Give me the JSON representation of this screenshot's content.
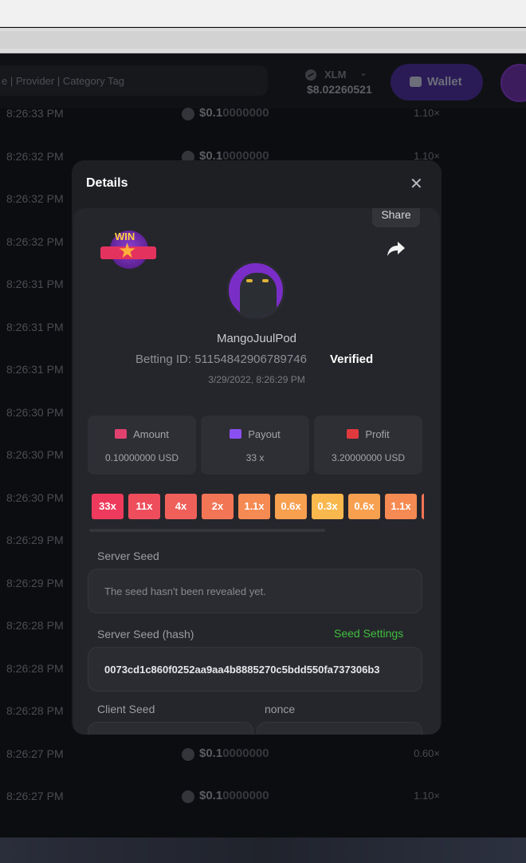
{
  "header": {
    "search_placeholder": "e | Provider | Category Tag",
    "currency_code": "XLM",
    "balance": "$8.02260521",
    "wallet_label": "Wallet"
  },
  "bets": [
    {
      "time": "8:26:33 PM",
      "amount_main": "$0.1",
      "amount_dim": "0000000",
      "multiplier": "1.10×",
      "show_amount": true,
      "show_mult": true
    },
    {
      "time": "8:26:32 PM",
      "amount_main": "$0.1",
      "amount_dim": "0000000",
      "multiplier": "1.10×",
      "show_amount": true,
      "show_mult": true
    },
    {
      "time": "8:26:32 PM",
      "show_amount": false,
      "show_mult": false
    },
    {
      "time": "8:26:32 PM",
      "show_amount": false,
      "show_mult": false
    },
    {
      "time": "8:26:31 PM",
      "show_amount": false,
      "show_mult": false
    },
    {
      "time": "8:26:31 PM",
      "show_amount": false,
      "show_mult": false
    },
    {
      "time": "8:26:31 PM",
      "show_amount": false,
      "show_mult": false
    },
    {
      "time": "8:26:30 PM",
      "show_amount": false,
      "show_mult": false
    },
    {
      "time": "8:26:30 PM",
      "show_amount": false,
      "show_mult": false
    },
    {
      "time": "8:26:30 PM",
      "show_amount": false,
      "show_mult": false
    },
    {
      "time": "8:26:29 PM",
      "show_amount": false,
      "show_mult": false
    },
    {
      "time": "8:26:29 PM",
      "show_amount": false,
      "show_mult": false
    },
    {
      "time": "8:26:28 PM",
      "show_amount": false,
      "show_mult": false
    },
    {
      "time": "8:26:28 PM",
      "show_amount": false,
      "show_mult": false
    },
    {
      "time": "8:26:28 PM",
      "show_amount": false,
      "show_mult": false
    },
    {
      "time": "8:26:27 PM",
      "amount_main": "$0.1",
      "amount_dim": "0000000",
      "multiplier": "0.60×",
      "show_amount": true,
      "show_mult": true
    },
    {
      "time": "8:26:27 PM",
      "amount_main": "$0.1",
      "amount_dim": "0000000",
      "multiplier": "1.10×",
      "show_amount": true,
      "show_mult": true
    }
  ],
  "modal": {
    "title": "Details",
    "close_icon": "close-icon",
    "share_label": "Share",
    "win_badge_text": "WIN",
    "username": "MangoJuulPod",
    "betting_id": "Betting ID: 5115484290678974​6",
    "verified": "Verified",
    "date": "3/29/2022, 8:26:29 PM",
    "stats": [
      {
        "label": "Amount",
        "value": "0.10000000 USD",
        "icon": "hand-money-icon",
        "color": "#e0416e"
      },
      {
        "label": "Payout",
        "value": "33 x",
        "icon": "wallet-icon",
        "color": "#8a4ff0"
      },
      {
        "label": "Profit",
        "value": "3.20000000 USD",
        "icon": "hand-coin-icon",
        "color": "#e0393e"
      }
    ],
    "multipliers": [
      {
        "label": "33x",
        "color": "#ee3a5c"
      },
      {
        "label": "11x",
        "color": "#ee4d5c"
      },
      {
        "label": "4x",
        "color": "#f0605a"
      },
      {
        "label": "2x",
        "color": "#f27556"
      },
      {
        "label": "1.1x",
        "color": "#f58a52"
      },
      {
        "label": "0.6x",
        "color": "#f7a050"
      },
      {
        "label": "0.3x",
        "color": "#f9b84e"
      },
      {
        "label": "0.6x",
        "color": "#f7a050"
      },
      {
        "label": "1.1x",
        "color": "#f58a52"
      },
      {
        "label": "",
        "color": "#f27556"
      }
    ],
    "server_seed_label": "Server Seed",
    "server_seed_value": "The seed hasn't been revealed yet.",
    "server_seed_hash_label": "Server Seed (hash)",
    "seed_settings": "Seed Settings",
    "server_seed_hash": "0073cd1c860f0252aa9aa4b8885270c5bdd550fa737306b3",
    "client_seed_label": "Client Seed",
    "nonce_label": "nonce"
  }
}
